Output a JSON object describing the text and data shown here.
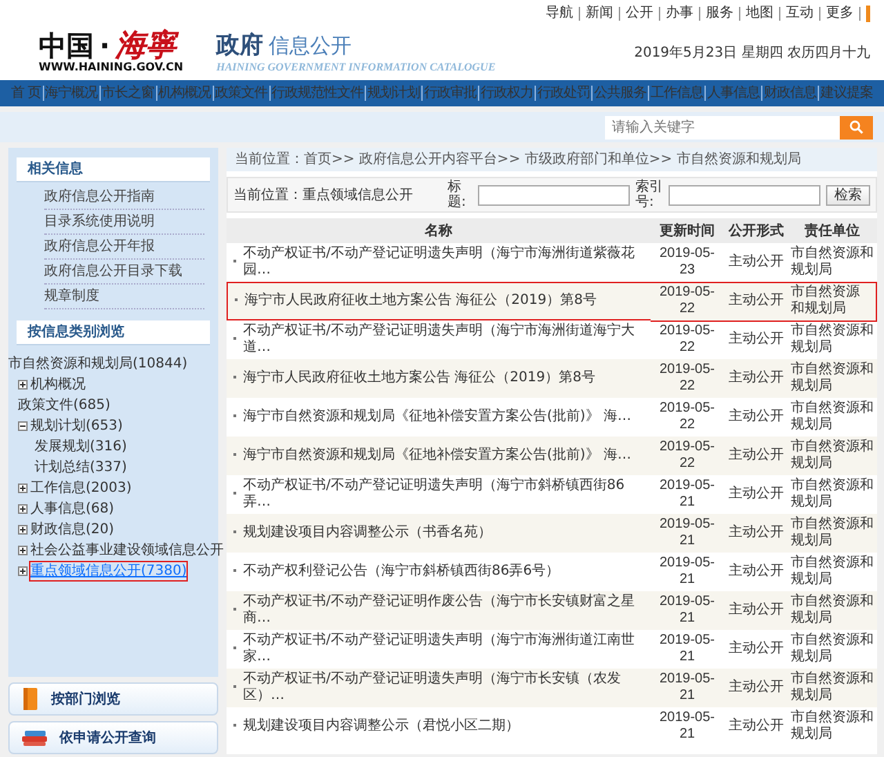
{
  "header": {
    "top_links": [
      "导航",
      "新闻",
      "公开",
      "办事",
      "服务",
      "地图",
      "互动",
      "更多"
    ],
    "logo": {
      "cn": "中国",
      "dot": "·",
      "city": "海寧",
      "url": "WWW.HAINING.GOV.CN"
    },
    "title_main": "政府",
    "title_sub": "信息公开",
    "title_en": "HAINING GOVERNMENT INFORMATION CATALOGUE",
    "date": "2019年5月23日  星期四  农历四月十九"
  },
  "nav": [
    "首 页",
    "海宁概况",
    "市长之窗",
    "机构概况",
    "政策文件",
    "行政规范性文件",
    "规划计划",
    "行政审批",
    "行政权力",
    "行政处罚",
    "公共服务",
    "工作信息",
    "人事信息",
    "财政信息",
    "建议提案"
  ],
  "search": {
    "placeholder": "请输入关键字"
  },
  "sidebar": {
    "related_title": "相关信息",
    "related_links": [
      "政府信息公开指南",
      "目录系统使用说明",
      "政府信息公开年报",
      "政府信息公开目录下载",
      "规章制度"
    ],
    "browse_title": "按信息类别浏览",
    "tree": {
      "label": "市自然资源和规划局(10844)",
      "children": [
        {
          "label": "机构概况",
          "expanded": false,
          "highlighted": false
        },
        {
          "label": "政策文件(685)",
          "highlighted": false
        },
        {
          "label": "规划计划(653)",
          "expanded": true,
          "highlighted": false,
          "children": [
            {
              "label": "发展规划(316)",
              "highlighted": false
            },
            {
              "label": "计划总结(337)",
              "highlighted": false
            }
          ]
        },
        {
          "label": "工作信息(2003)",
          "expanded": false,
          "highlighted": false
        },
        {
          "label": "人事信息(68)",
          "expanded": false,
          "highlighted": false
        },
        {
          "label": "财政信息(20)",
          "expanded": false,
          "highlighted": false
        },
        {
          "label": "社会公益事业建设领域信息公开",
          "expanded": false,
          "highlighted": false
        },
        {
          "label": "重点领域信息公开(7380)",
          "expanded": false,
          "highlighted": true
        }
      ]
    },
    "buttons": [
      {
        "kind": "book",
        "label": "按部门浏览"
      },
      {
        "kind": "books",
        "label": "依申请公开查询"
      }
    ]
  },
  "breadcrumb": "当前位置：首页>> 政府信息公开内容平台>> 市级政府部门和单位>> 市自然资源和规划局",
  "filter": {
    "location": "当前位置：重点领域信息公开",
    "title_label": "标题:",
    "index_label": "索引号:",
    "button": "检索"
  },
  "table": {
    "columns": [
      "名称",
      "更新时间",
      "公开形式",
      "责任单位"
    ],
    "rows": [
      {
        "name": "不动产权证书/不动产登记证明遗失声明（海宁市海洲街道紫薇花园…",
        "date": "2019-05-23",
        "form": "主动公开",
        "unit": "市自然资源和规划局",
        "highlighted": false
      },
      {
        "name": "海宁市人民政府征收土地方案公告 海征公（2019）第8号",
        "date": "2019-05-22",
        "form": "主动公开",
        "unit": "市自然资源和规划局",
        "highlighted": true
      },
      {
        "name": "不动产权证书/不动产登记证明遗失声明（海宁市海洲街道海宁大道…",
        "date": "2019-05-22",
        "form": "主动公开",
        "unit": "市自然资源和规划局",
        "highlighted": false
      },
      {
        "name": "海宁市人民政府征收土地方案公告 海征公（2019）第8号",
        "date": "2019-05-22",
        "form": "主动公开",
        "unit": "市自然资源和规划局",
        "highlighted": false
      },
      {
        "name": "海宁市自然资源和规划局《征地补偿安置方案公告(批前)》 海…",
        "date": "2019-05-22",
        "form": "主动公开",
        "unit": "市自然资源和规划局",
        "highlighted": false
      },
      {
        "name": "海宁市自然资源和规划局《征地补偿安置方案公告(批前)》 海…",
        "date": "2019-05-22",
        "form": "主动公开",
        "unit": "市自然资源和规划局",
        "highlighted": false
      },
      {
        "name": "不动产权证书/不动产登记证明遗失声明（海宁市斜桥镇西街86弄…",
        "date": "2019-05-21",
        "form": "主动公开",
        "unit": "市自然资源和规划局",
        "highlighted": false
      },
      {
        "name": "规划建设项目内容调整公示（书香名苑）",
        "date": "2019-05-21",
        "form": "主动公开",
        "unit": "市自然资源和规划局",
        "highlighted": false
      },
      {
        "name": "不动产权利登记公告（海宁市斜桥镇西街86弄6号）",
        "date": "2019-05-21",
        "form": "主动公开",
        "unit": "市自然资源和规划局",
        "highlighted": false
      },
      {
        "name": "不动产权证书/不动产登记证明作废公告（海宁市长安镇财富之星商…",
        "date": "2019-05-21",
        "form": "主动公开",
        "unit": "市自然资源和规划局",
        "highlighted": false
      },
      {
        "name": "不动产权证书/不动产登记证明遗失声明（海宁市海洲街道江南世家…",
        "date": "2019-05-21",
        "form": "主动公开",
        "unit": "市自然资源和规划局",
        "highlighted": false
      },
      {
        "name": "不动产权证书/不动产登记证明遗失声明（海宁市长安镇（农发区）…",
        "date": "2019-05-21",
        "form": "主动公开",
        "unit": "市自然资源和规划局",
        "highlighted": false
      },
      {
        "name": "规划建设项目内容调整公示（君悦小区二期）",
        "date": "2019-05-21",
        "form": "主动公开",
        "unit": "市自然资源和规划局",
        "highlighted": false
      }
    ]
  }
}
